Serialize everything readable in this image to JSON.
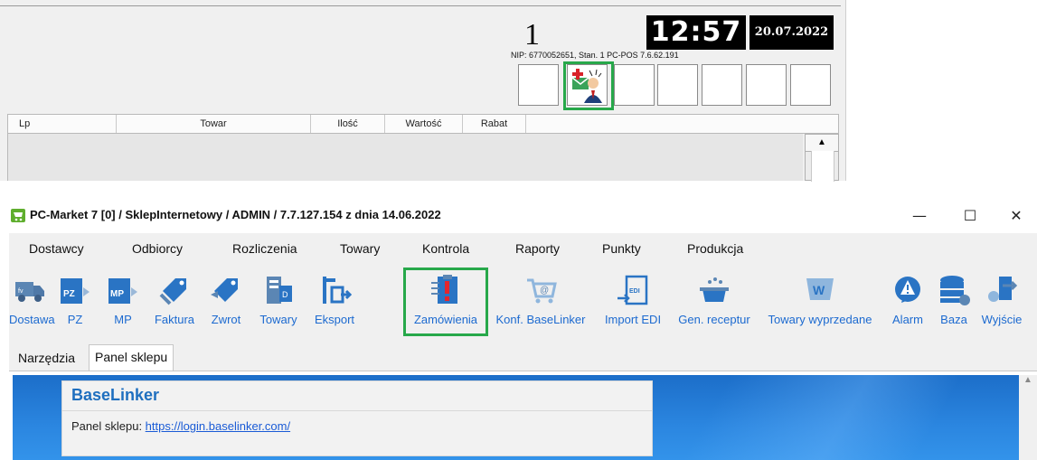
{
  "pos": {
    "counter": "1",
    "clock": "12:57",
    "date": "20.07.2022",
    "nip_line": "NIP: 6770052651, Stan. 1 PC-POS 7.6.62.191",
    "grid_columns": [
      "Lp",
      "Towar",
      "Ilość",
      "Wartość",
      "Rabat"
    ]
  },
  "window": {
    "title": "PC-Market 7 [0] / SklepInternetowy / ADMIN / 7.7.127.154 z dnia 14.06.2022",
    "controls": {
      "minimize": "—",
      "maximize": "☐",
      "close": "✕"
    },
    "menu": [
      "Dostawcy",
      "Odbiorcy",
      "Rozliczenia",
      "Towary",
      "Kontrola",
      "Raporty",
      "Punkty",
      "Produkcja"
    ],
    "toolbar": [
      "Dostawa",
      "PZ",
      "MP",
      "Faktura",
      "Zwrot",
      "Towary",
      "Eksport",
      "Zamówienia",
      "Konf. BaseLinker",
      "Import EDI",
      "Gen. receptur",
      "Towary wyprzedane",
      "Alarm",
      "Baza",
      "Wyjście"
    ],
    "icon_names": [
      "truck-icon",
      "pz-document-icon",
      "mp-document-icon",
      "invoice-tag-icon",
      "return-tag-icon",
      "products-icon",
      "export-icon",
      "orders-clipboard-icon",
      "baselinker-cart-icon",
      "edi-import-icon",
      "recipe-pot-icon",
      "sale-cart-icon",
      "alarm-icon",
      "database-icon",
      "exit-icon"
    ],
    "tabs": [
      "Narzędzia",
      "Panel sklepu"
    ],
    "panel": {
      "heading": "BaseLinker",
      "label": "Panel sklepu: ",
      "link": "https://login.baselinker.com/"
    }
  },
  "colors": {
    "accent_link": "#1c6ad0",
    "highlight_box": "#27a84a",
    "panel_blue": "#2b86e0"
  }
}
